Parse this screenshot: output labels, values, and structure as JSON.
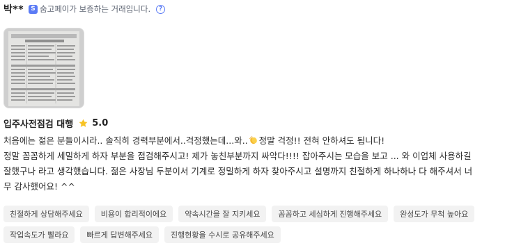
{
  "review": {
    "reviewer_name": "박**",
    "pay_badge": {
      "logo_letter": "S",
      "text": "숨고페이가 보증하는 거래입니다.",
      "help_symbol": "?",
      "logo_color": "#5b7bf5"
    },
    "photo_icon": "document-photo-thumbnail",
    "service_name": "입주사전점검 대행",
    "rating": "5.0",
    "star_color": "#f7c325",
    "body": {
      "line1_before_emoji": "처음에는 젊은 분들이시라.. 솔직히 경력부분에서..걱정했는데...와..",
      "emoji_icon": "clapping-hands-icon",
      "line1_after_emoji": "정말 걱정!! 전혀 안하셔도 됩니다!",
      "line2": "정말 꼼꼼하게 세밀하게 하자 부분을 점검해주시고! 제가 놓친부분까지 싸악다!!!! 잡아주시는 모습을 보고 ... 와 이업체 사용하길",
      "line3": "잘했구나 라고 생각했습니다. 젊은 사장님 두분이서 기계로 정밀하게 하자 찾아주시고 설명까지 친절하게 하나하나 다 해주셔서 너",
      "line4": "무 감사했어요! ^^"
    },
    "tags": [
      "친절하게 상담해주세요",
      "비용이 합리적이에요",
      "약속시간을 잘 지키세요",
      "꼼꼼하고 세심하게 진행해주세요",
      "완성도가 무척 높아요",
      "작업속도가 빨라요",
      "빠르게 답변해주세요",
      "진행현황을 수시로 공유해주세요"
    ]
  }
}
